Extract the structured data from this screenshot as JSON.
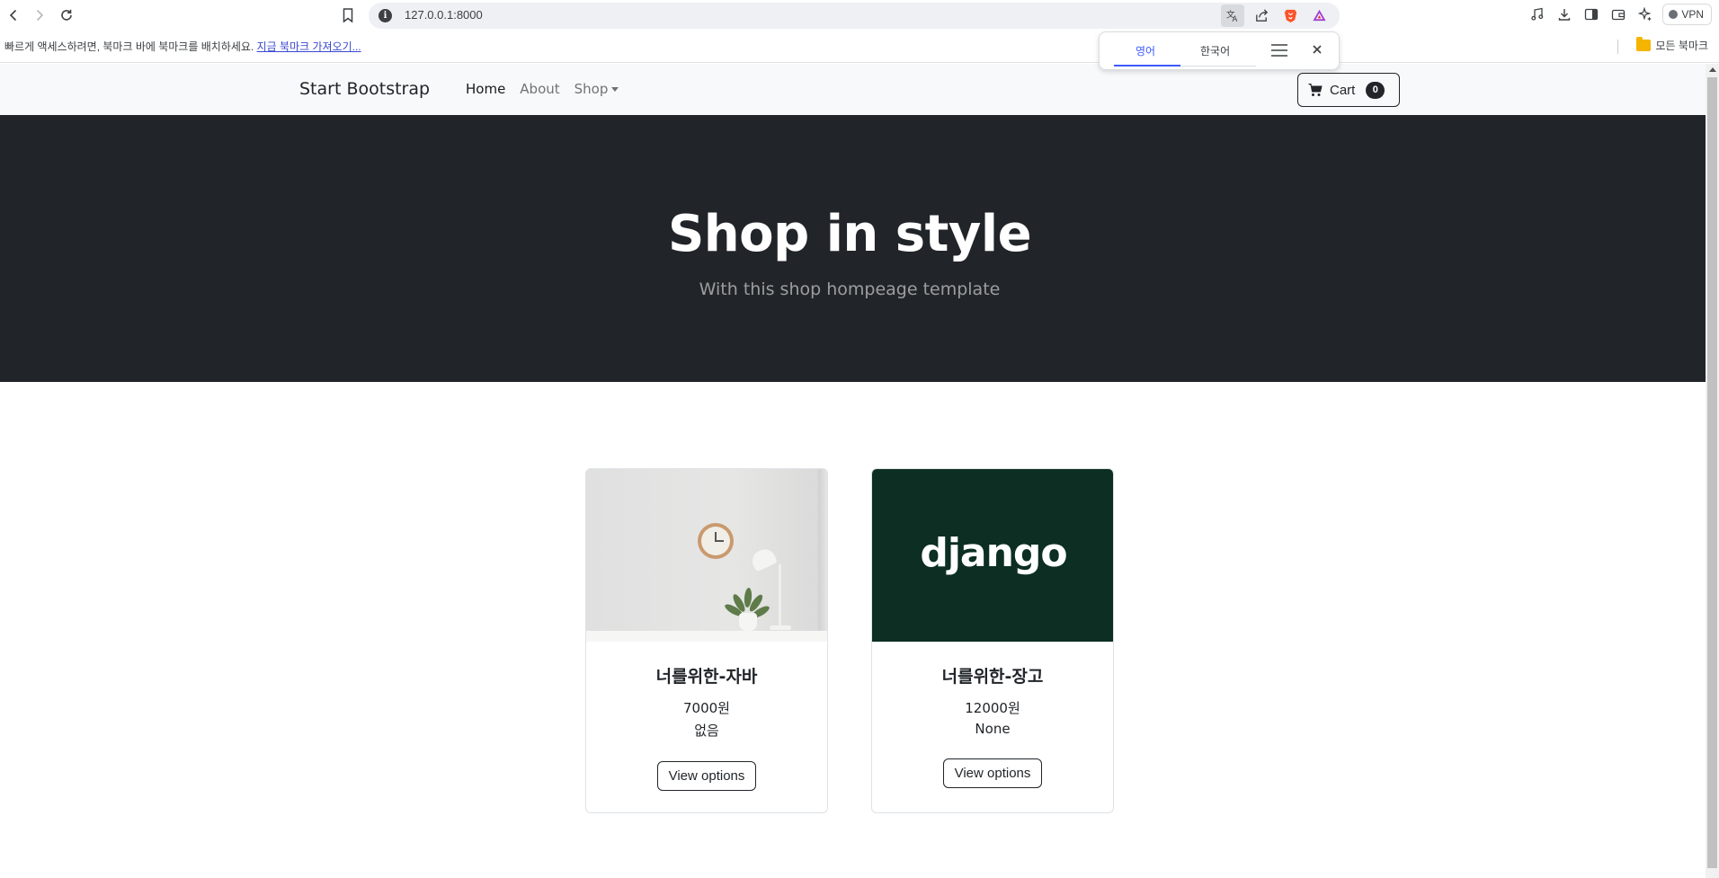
{
  "browser": {
    "url": "127.0.0.1:8000",
    "vpn_label": "VPN",
    "bookmarks_prompt": "빠르게 액세스하려면, 북마크 바에 북마크를 배치하세요.",
    "bookmarks_import_link": "지금 북마크 가져오기...",
    "all_bookmarks_label": "모든 북마크",
    "translate": {
      "tab_source": "영어",
      "tab_target": "한국어",
      "accent_color": "#3d5afe"
    }
  },
  "site": {
    "brand": "Start Bootstrap",
    "nav": [
      {
        "label": "Home"
      },
      {
        "label": "About"
      },
      {
        "label": "Shop"
      }
    ],
    "cart": {
      "label": "Cart",
      "count": "0"
    },
    "hero": {
      "title": "Shop in style",
      "subtitle": "With this shop hompeage template",
      "bg_color": "#212529"
    },
    "products": [
      {
        "name": "너를위한-자바",
        "price": "7000원",
        "desc": "없음",
        "button": "View options",
        "image": "room-desk-photo"
      },
      {
        "name": "너를위한-장고",
        "price": "12000원",
        "desc": "None",
        "button": "View options",
        "image": "django-logo",
        "logo_text": "django"
      }
    ]
  }
}
